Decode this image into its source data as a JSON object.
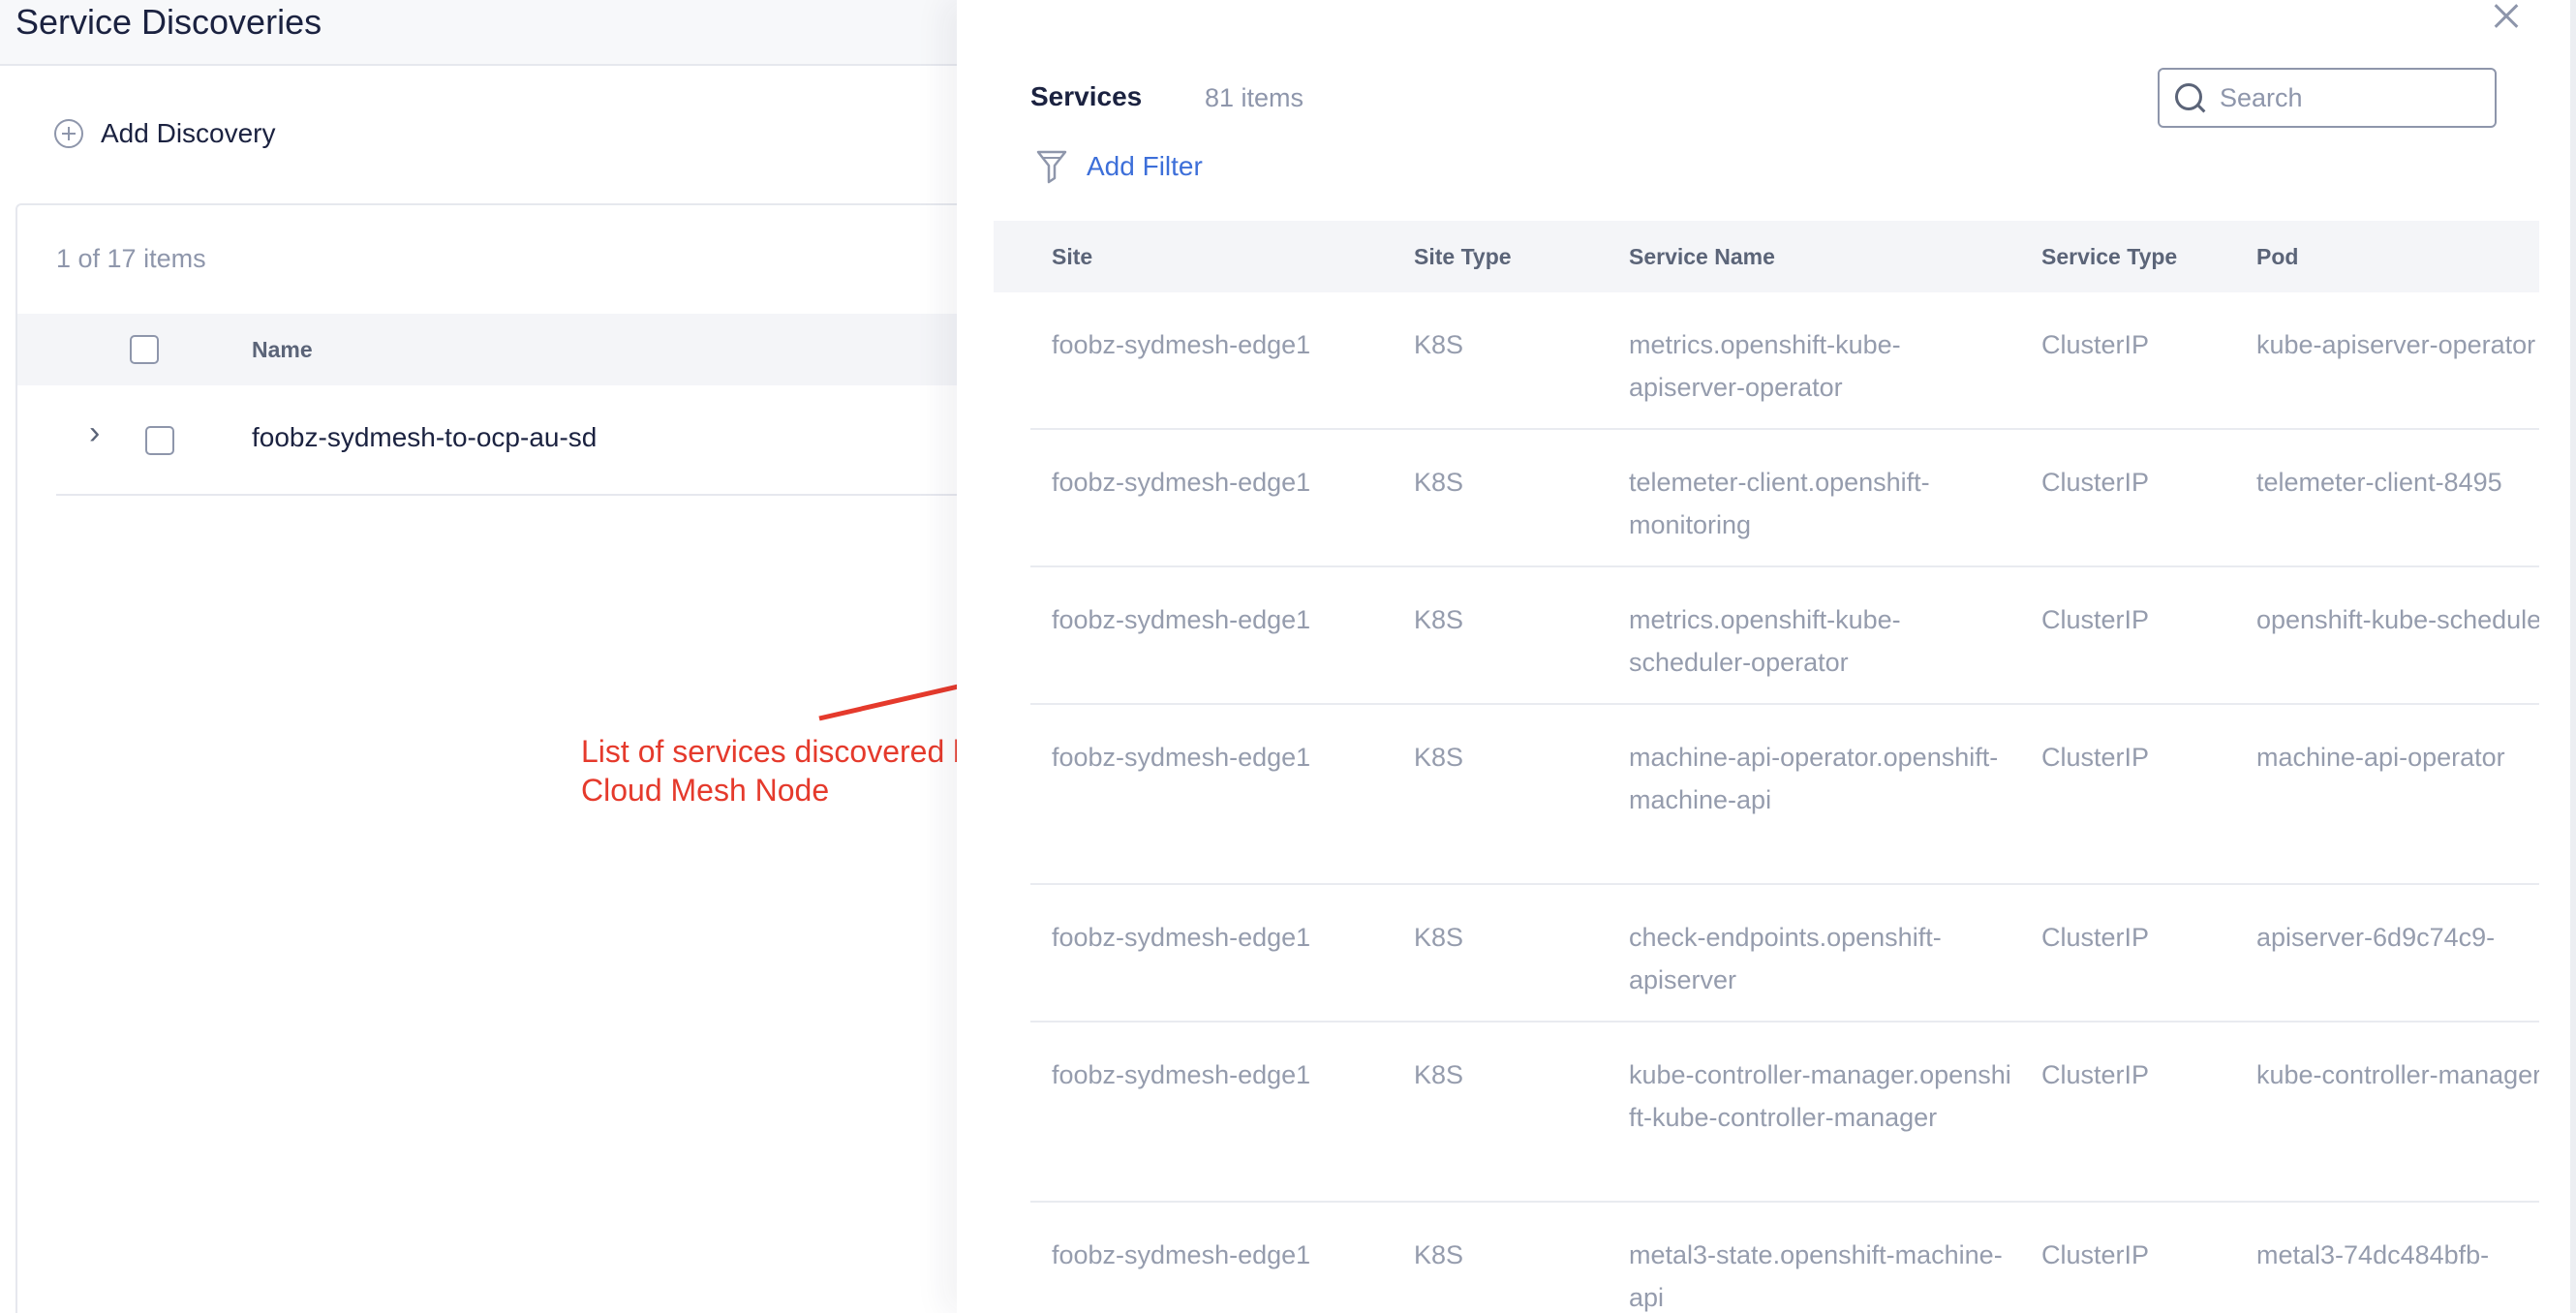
{
  "page": {
    "title": "Service Discoveries",
    "add_discovery_label": "Add Discovery",
    "item_count": "1 of 17 items",
    "table_header_name": "Name",
    "rows": [
      {
        "name": "foobz-sydmesh-to-ocp-au-sd"
      }
    ]
  },
  "annotation": {
    "text": "List of services discovered by Cloud Mesh Node",
    "color": "#e53a2c"
  },
  "drawer": {
    "title": "Services",
    "count": "81 items",
    "search_placeholder": "Search",
    "add_filter_label": "Add Filter",
    "columns": [
      "Site",
      "Site Type",
      "Service Name",
      "Service Type",
      "Pod"
    ],
    "rows": [
      {
        "site": "foobz-sydmesh-edge1",
        "site_type": "K8S",
        "service_name": "metrics.openshift-kube-apiserver-operator",
        "service_type": "ClusterIP",
        "pod": "kube-apiserver-operator"
      },
      {
        "site": "foobz-sydmesh-edge1",
        "site_type": "K8S",
        "service_name": "telemeter-client.openshift-monitoring",
        "service_type": "ClusterIP",
        "pod": "telemeter-client-8495"
      },
      {
        "site": "foobz-sydmesh-edge1",
        "site_type": "K8S",
        "service_name": "metrics.openshift-kube-scheduler-operator",
        "service_type": "ClusterIP",
        "pod": "openshift-kube-scheduler"
      },
      {
        "site": "foobz-sydmesh-edge1",
        "site_type": "K8S",
        "service_name": "machine-api-operator.openshift-machine-api",
        "service_type": "ClusterIP",
        "pod": "machine-api-operator"
      },
      {
        "site": "foobz-sydmesh-edge1",
        "site_type": "K8S",
        "service_name": "check-endpoints.openshift-apiserver",
        "service_type": "ClusterIP",
        "pod": "apiserver-6d9c74c9-"
      },
      {
        "site": "foobz-sydmesh-edge1",
        "site_type": "K8S",
        "service_name": "kube-controller-manager.openshift-kube-controller-manager",
        "service_type": "ClusterIP",
        "pod": "kube-controller-manager"
      },
      {
        "site": "foobz-sydmesh-edge1",
        "site_type": "K8S",
        "service_name": "metal3-state.openshift-machine-api",
        "service_type": "ClusterIP",
        "pod": "metal3-74dc484bfb-"
      }
    ]
  },
  "colors": {
    "accent": "#3d6fd9",
    "text_primary": "#1b2240",
    "text_muted": "#959cad",
    "header_bg": "#f4f5f8"
  }
}
